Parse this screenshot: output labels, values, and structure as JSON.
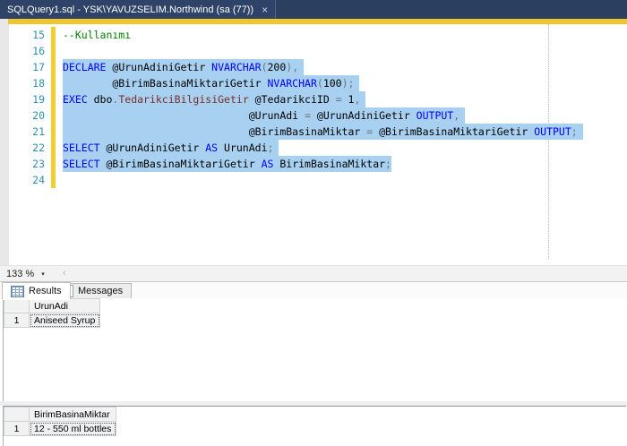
{
  "tab": {
    "title": "SQLQuery1.sql - YSK\\YAVUZSELIM.Northwind (sa (77))",
    "close": "×"
  },
  "editor": {
    "zoom_value": "133 %",
    "zoom_arrow": "▾",
    "scroll_left_arrow": "‹",
    "lines": [
      {
        "num": "15",
        "sel": false,
        "ext": false,
        "segments": [
          {
            "c": "comment",
            "t": "--Kullanımı"
          }
        ]
      },
      {
        "num": "16",
        "sel": false,
        "ext": false,
        "segments": []
      },
      {
        "num": "17",
        "sel": true,
        "ext": true,
        "segments": [
          {
            "c": "kw",
            "t": "DECLARE"
          },
          {
            "c": "id",
            "t": " @UrunAdiniGetir "
          },
          {
            "c": "kw",
            "t": "NVARCHAR"
          },
          {
            "c": "op",
            "t": "("
          },
          {
            "c": "num",
            "t": "200"
          },
          {
            "c": "op",
            "t": "),"
          }
        ]
      },
      {
        "num": "18",
        "sel": true,
        "ext": true,
        "segments": [
          {
            "c": "id",
            "t": "        @BirimBasinaMiktariGetir "
          },
          {
            "c": "kw",
            "t": "NVARCHAR"
          },
          {
            "c": "op",
            "t": "("
          },
          {
            "c": "num",
            "t": "100"
          },
          {
            "c": "op",
            "t": ");"
          }
        ]
      },
      {
        "num": "19",
        "sel": true,
        "ext": true,
        "segments": [
          {
            "c": "kw",
            "t": "EXEC"
          },
          {
            "c": "id",
            "t": " dbo"
          },
          {
            "c": "op",
            "t": "."
          },
          {
            "c": "proc",
            "t": "TedarikciBilgisiGetir"
          },
          {
            "c": "id",
            "t": " @TedarikciID "
          },
          {
            "c": "op",
            "t": "= "
          },
          {
            "c": "num",
            "t": "1"
          },
          {
            "c": "op",
            "t": ","
          }
        ]
      },
      {
        "num": "20",
        "sel": true,
        "ext": true,
        "segments": [
          {
            "c": "id",
            "t": "                              @UrunAdi "
          },
          {
            "c": "op",
            "t": "= "
          },
          {
            "c": "id",
            "t": "@UrunAdiniGetir "
          },
          {
            "c": "kw",
            "t": "OUTPUT"
          },
          {
            "c": "op",
            "t": ","
          }
        ]
      },
      {
        "num": "21",
        "sel": true,
        "ext": true,
        "segments": [
          {
            "c": "id",
            "t": "                              @BirimBasinaMiktar "
          },
          {
            "c": "op",
            "t": "= "
          },
          {
            "c": "id",
            "t": "@BirimBasinaMiktariGetir "
          },
          {
            "c": "kw",
            "t": "OUTPUT"
          },
          {
            "c": "op",
            "t": ";"
          }
        ]
      },
      {
        "num": "22",
        "sel": true,
        "ext": true,
        "segments": [
          {
            "c": "kw",
            "t": "SELECT"
          },
          {
            "c": "id",
            "t": " @UrunAdiniGetir "
          },
          {
            "c": "kw",
            "t": "AS"
          },
          {
            "c": "id",
            "t": " UrunAdi"
          },
          {
            "c": "op",
            "t": ";"
          }
        ]
      },
      {
        "num": "23",
        "sel": true,
        "ext": false,
        "segments": [
          {
            "c": "kw",
            "t": "SELECT"
          },
          {
            "c": "id",
            "t": " @BirimBasinaMiktariGetir "
          },
          {
            "c": "kw",
            "t": "AS"
          },
          {
            "c": "id",
            "t": " BirimBasinaMiktar"
          },
          {
            "c": "op",
            "t": ";"
          }
        ]
      },
      {
        "num": "24",
        "sel": false,
        "ext": false,
        "segments": []
      }
    ]
  },
  "results_pane": {
    "tabs": [
      {
        "label": "Results"
      },
      {
        "label": "Messages"
      }
    ],
    "grids": [
      {
        "column": "UrunAdi",
        "rows": [
          {
            "n": "1",
            "value": "Aniseed Syrup"
          }
        ]
      },
      {
        "column": "BirimBasinaMiktar",
        "rows": [
          {
            "n": "1",
            "value": "12 - 550 ml bottles"
          }
        ]
      }
    ]
  },
  "colors": {
    "tab_bar_bg": "#2b3f61",
    "accent_gold": "#f0c62e",
    "selection_blue": "#a8d0f0",
    "keyword_blue": "#0000ff",
    "comment_green": "#008000",
    "proc_maroon": "#7a2d24",
    "line_number_teal": "#2b91af"
  }
}
